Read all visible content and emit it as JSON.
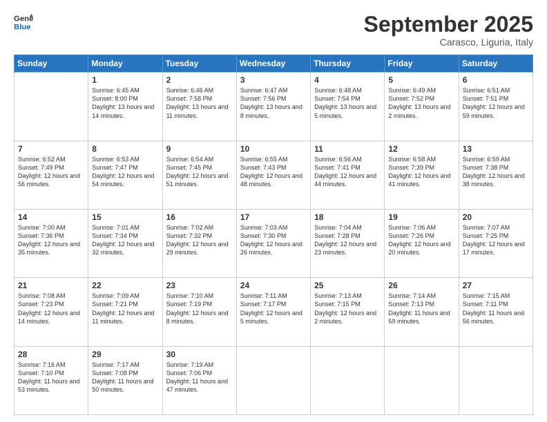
{
  "logo": {
    "line1": "General",
    "line2": "Blue"
  },
  "header": {
    "month": "September 2025",
    "location": "Carasco, Liguria, Italy"
  },
  "weekdays": [
    "Sunday",
    "Monday",
    "Tuesday",
    "Wednesday",
    "Thursday",
    "Friday",
    "Saturday"
  ],
  "rows": [
    [
      {
        "day": "",
        "sunrise": "",
        "sunset": "",
        "daylight": ""
      },
      {
        "day": "1",
        "sunrise": "Sunrise: 6:45 AM",
        "sunset": "Sunset: 8:00 PM",
        "daylight": "Daylight: 13 hours and 14 minutes."
      },
      {
        "day": "2",
        "sunrise": "Sunrise: 6:46 AM",
        "sunset": "Sunset: 7:58 PM",
        "daylight": "Daylight: 13 hours and 11 minutes."
      },
      {
        "day": "3",
        "sunrise": "Sunrise: 6:47 AM",
        "sunset": "Sunset: 7:56 PM",
        "daylight": "Daylight: 13 hours and 8 minutes."
      },
      {
        "day": "4",
        "sunrise": "Sunrise: 6:48 AM",
        "sunset": "Sunset: 7:54 PM",
        "daylight": "Daylight: 13 hours and 5 minutes."
      },
      {
        "day": "5",
        "sunrise": "Sunrise: 6:49 AM",
        "sunset": "Sunset: 7:52 PM",
        "daylight": "Daylight: 13 hours and 2 minutes."
      },
      {
        "day": "6",
        "sunrise": "Sunrise: 6:51 AM",
        "sunset": "Sunset: 7:51 PM",
        "daylight": "Daylight: 12 hours and 59 minutes."
      }
    ],
    [
      {
        "day": "7",
        "sunrise": "Sunrise: 6:52 AM",
        "sunset": "Sunset: 7:49 PM",
        "daylight": "Daylight: 12 hours and 56 minutes."
      },
      {
        "day": "8",
        "sunrise": "Sunrise: 6:53 AM",
        "sunset": "Sunset: 7:47 PM",
        "daylight": "Daylight: 12 hours and 54 minutes."
      },
      {
        "day": "9",
        "sunrise": "Sunrise: 6:54 AM",
        "sunset": "Sunset: 7:45 PM",
        "daylight": "Daylight: 12 hours and 51 minutes."
      },
      {
        "day": "10",
        "sunrise": "Sunrise: 6:55 AM",
        "sunset": "Sunset: 7:43 PM",
        "daylight": "Daylight: 12 hours and 48 minutes."
      },
      {
        "day": "11",
        "sunrise": "Sunrise: 6:56 AM",
        "sunset": "Sunset: 7:41 PM",
        "daylight": "Daylight: 12 hours and 44 minutes."
      },
      {
        "day": "12",
        "sunrise": "Sunrise: 6:58 AM",
        "sunset": "Sunset: 7:39 PM",
        "daylight": "Daylight: 12 hours and 41 minutes."
      },
      {
        "day": "13",
        "sunrise": "Sunrise: 6:59 AM",
        "sunset": "Sunset: 7:38 PM",
        "daylight": "Daylight: 12 hours and 38 minutes."
      }
    ],
    [
      {
        "day": "14",
        "sunrise": "Sunrise: 7:00 AM",
        "sunset": "Sunset: 7:36 PM",
        "daylight": "Daylight: 12 hours and 35 minutes."
      },
      {
        "day": "15",
        "sunrise": "Sunrise: 7:01 AM",
        "sunset": "Sunset: 7:34 PM",
        "daylight": "Daylight: 12 hours and 32 minutes."
      },
      {
        "day": "16",
        "sunrise": "Sunrise: 7:02 AM",
        "sunset": "Sunset: 7:32 PM",
        "daylight": "Daylight: 12 hours and 29 minutes."
      },
      {
        "day": "17",
        "sunrise": "Sunrise: 7:03 AM",
        "sunset": "Sunset: 7:30 PM",
        "daylight": "Daylight: 12 hours and 26 minutes."
      },
      {
        "day": "18",
        "sunrise": "Sunrise: 7:04 AM",
        "sunset": "Sunset: 7:28 PM",
        "daylight": "Daylight: 12 hours and 23 minutes."
      },
      {
        "day": "19",
        "sunrise": "Sunrise: 7:06 AM",
        "sunset": "Sunset: 7:26 PM",
        "daylight": "Daylight: 12 hours and 20 minutes."
      },
      {
        "day": "20",
        "sunrise": "Sunrise: 7:07 AM",
        "sunset": "Sunset: 7:25 PM",
        "daylight": "Daylight: 12 hours and 17 minutes."
      }
    ],
    [
      {
        "day": "21",
        "sunrise": "Sunrise: 7:08 AM",
        "sunset": "Sunset: 7:23 PM",
        "daylight": "Daylight: 12 hours and 14 minutes."
      },
      {
        "day": "22",
        "sunrise": "Sunrise: 7:09 AM",
        "sunset": "Sunset: 7:21 PM",
        "daylight": "Daylight: 12 hours and 11 minutes."
      },
      {
        "day": "23",
        "sunrise": "Sunrise: 7:10 AM",
        "sunset": "Sunset: 7:19 PM",
        "daylight": "Daylight: 12 hours and 8 minutes."
      },
      {
        "day": "24",
        "sunrise": "Sunrise: 7:11 AM",
        "sunset": "Sunset: 7:17 PM",
        "daylight": "Daylight: 12 hours and 5 minutes."
      },
      {
        "day": "25",
        "sunrise": "Sunrise: 7:13 AM",
        "sunset": "Sunset: 7:15 PM",
        "daylight": "Daylight: 12 hours and 2 minutes."
      },
      {
        "day": "26",
        "sunrise": "Sunrise: 7:14 AM",
        "sunset": "Sunset: 7:13 PM",
        "daylight": "Daylight: 11 hours and 59 minutes."
      },
      {
        "day": "27",
        "sunrise": "Sunrise: 7:15 AM",
        "sunset": "Sunset: 7:11 PM",
        "daylight": "Daylight: 11 hours and 56 minutes."
      }
    ],
    [
      {
        "day": "28",
        "sunrise": "Sunrise: 7:16 AM",
        "sunset": "Sunset: 7:10 PM",
        "daylight": "Daylight: 11 hours and 53 minutes."
      },
      {
        "day": "29",
        "sunrise": "Sunrise: 7:17 AM",
        "sunset": "Sunset: 7:08 PM",
        "daylight": "Daylight: 11 hours and 50 minutes."
      },
      {
        "day": "30",
        "sunrise": "Sunrise: 7:19 AM",
        "sunset": "Sunset: 7:06 PM",
        "daylight": "Daylight: 11 hours and 47 minutes."
      },
      {
        "day": "",
        "sunrise": "",
        "sunset": "",
        "daylight": ""
      },
      {
        "day": "",
        "sunrise": "",
        "sunset": "",
        "daylight": ""
      },
      {
        "day": "",
        "sunrise": "",
        "sunset": "",
        "daylight": ""
      },
      {
        "day": "",
        "sunrise": "",
        "sunset": "",
        "daylight": ""
      }
    ]
  ]
}
